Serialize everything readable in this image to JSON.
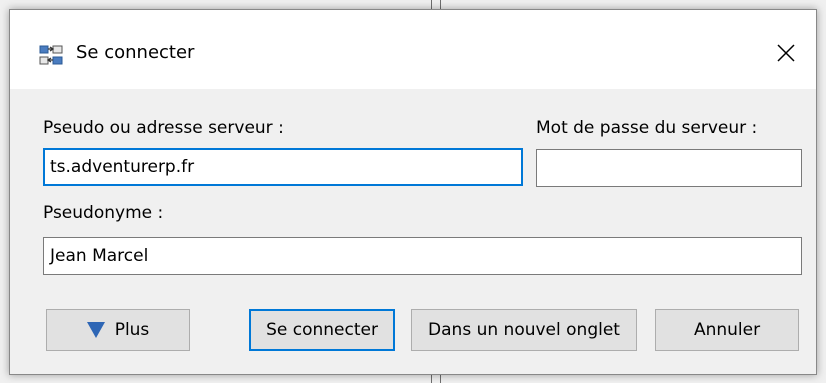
{
  "dialog": {
    "title": "Se connecter",
    "app_icon": "connect-icon",
    "close_icon": "close-icon"
  },
  "form": {
    "server_label": "Pseudo ou adresse serveur :",
    "server_value": "ts.adventurerp.fr",
    "password_label": "Mot de passe du serveur :",
    "password_value": "",
    "nickname_label": "Pseudonyme :",
    "nickname_value": "Jean Marcel"
  },
  "buttons": {
    "more_label": "Plus",
    "connect_label": "Se connecter",
    "new_tab_label": "Dans un nouvel onglet",
    "cancel_label": "Annuler"
  },
  "colors": {
    "accent": "#0078d7",
    "more_arrow": "#2e66b5"
  }
}
